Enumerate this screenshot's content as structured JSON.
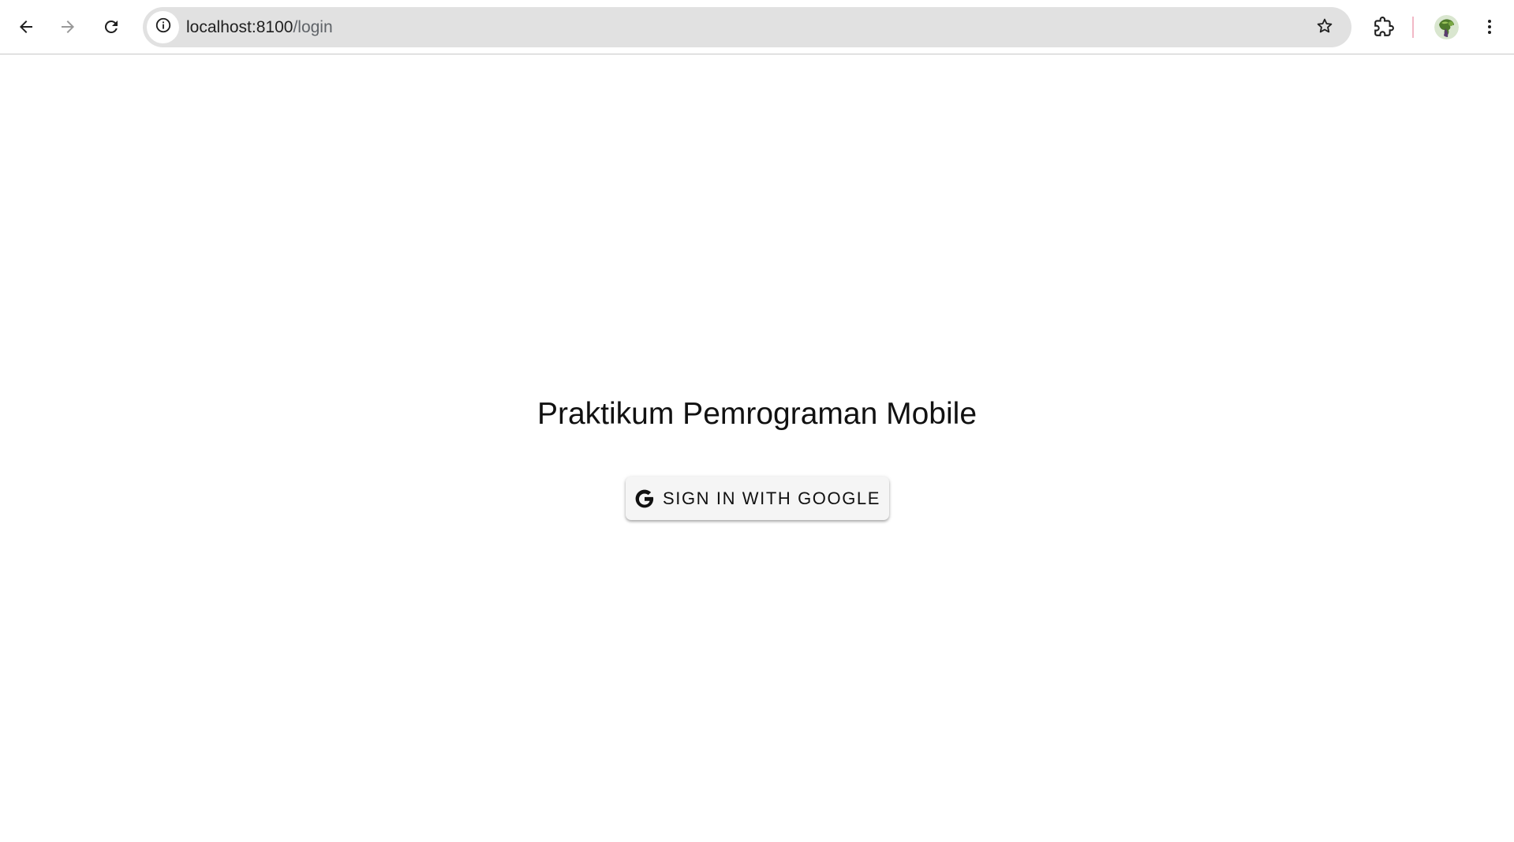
{
  "browser": {
    "url_host": "localhost:8100",
    "url_path": "/login",
    "icons": {
      "back": "arrow-left-icon",
      "forward": "arrow-right-icon",
      "reload": "reload-icon",
      "site_info": "info-icon",
      "bookmark": "star-icon",
      "extensions": "puzzle-icon",
      "menu": "kebab-menu-icon"
    },
    "colors": {
      "omnibox_bg": "#e1e1e1",
      "separator": "#f2b8c6"
    }
  },
  "page": {
    "title": "Praktikum Pemrograman Mobile",
    "google_button": {
      "label": "SIGN IN WITH GOOGLE",
      "icon": "google-g-icon"
    }
  }
}
